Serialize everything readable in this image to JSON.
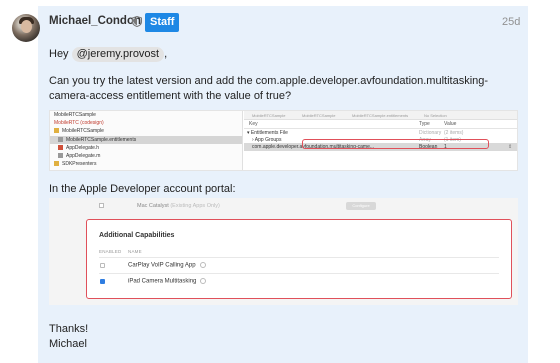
{
  "post": {
    "username": "Michael_Condon",
    "badge": "Staff",
    "time": "25d",
    "greeting_prefix": "Hey",
    "mention": "@jeremy.provost",
    "greeting_suffix": ",",
    "paragraph1": "Can you try the latest version and add the com.apple.developer.avfoundation.multitasking-camera-access entitlement with the value of true?",
    "paragraph2": "In the Apple Developer account portal:",
    "thanks": "Thanks!",
    "signature": "Michael"
  },
  "xcode": {
    "navigator": [
      "MobileRTCSample",
      "MobileRTC (codesign)",
      "MobileRTCSample",
      "MobileRTCSample.entitlements",
      "AppDelegate.h",
      "AppDelegate.m",
      "SDKPresenters"
    ],
    "tabs": [
      "MobileRTCSample",
      "MobileRTCSample",
      "MobileRTCSample.entitlements",
      "No Selection"
    ],
    "columns": {
      "key": "Key",
      "type": "Type",
      "value": "Value"
    },
    "rows": [
      {
        "key": "Entitlements File",
        "type": "Dictionary",
        "value": "(2 items)"
      },
      {
        "key": "App Groups",
        "type": "Array",
        "value": "(1 item)"
      },
      {
        "key": "com.apple.developer.avfoundation.multitasking-came...",
        "type": "Boolean",
        "value": "1"
      }
    ]
  },
  "portal": {
    "top_item": "Mac Catalyst",
    "top_item_note": "(Existing Apps Only)",
    "top_button": "Configure",
    "section_title": "Additional Capabilities",
    "col_enabled": "ENABLED",
    "col_name": "NAME",
    "capabilities": [
      {
        "name": "CarPlay VoIP Calling App",
        "enabled": false
      },
      {
        "name": "iPad Camera Multitasking",
        "enabled": true
      }
    ]
  }
}
